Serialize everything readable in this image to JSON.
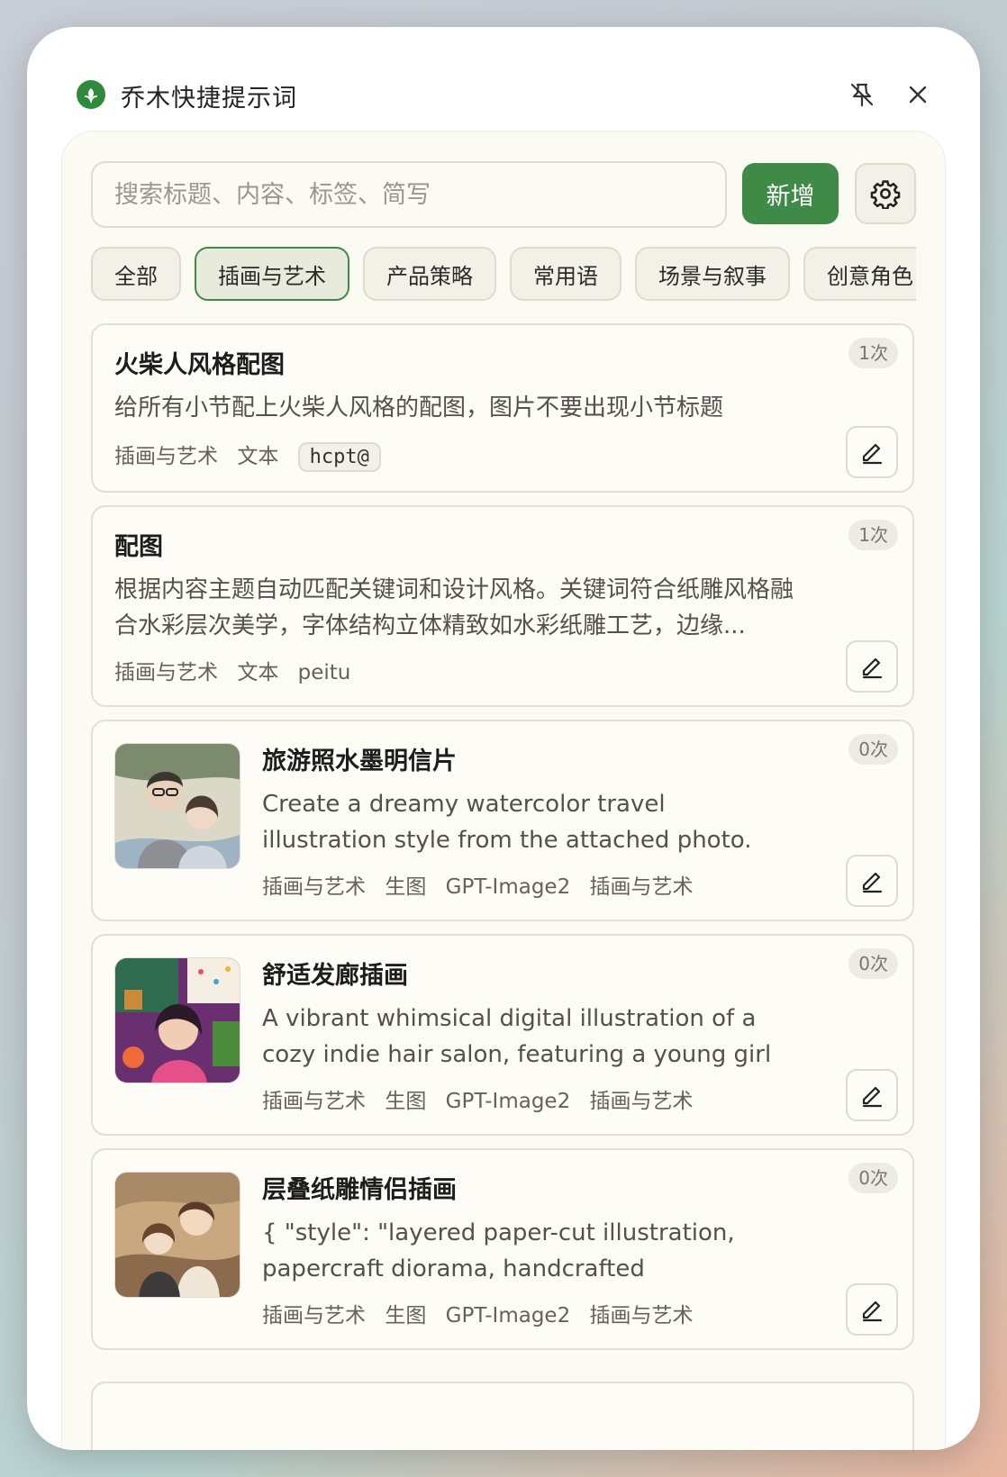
{
  "window": {
    "title": "乔木快捷提示词"
  },
  "toolbar": {
    "search_placeholder": "搜索标题、内容、标签、简写",
    "new_label": "新增"
  },
  "tabs": [
    {
      "label": "全部",
      "active": false
    },
    {
      "label": "插画与艺术",
      "active": true
    },
    {
      "label": "产品策略",
      "active": false
    },
    {
      "label": "常用语",
      "active": false
    },
    {
      "label": "场景与叙事",
      "active": false
    },
    {
      "label": "创意角色",
      "active": false
    }
  ],
  "cards": [
    {
      "title": "火柴人风格配图",
      "desc": "给所有小节配上火柴人风格的配图，图片不要出现小节标题",
      "tags": [
        "插画与艺术",
        "文本"
      ],
      "shortcut": "hcpt@",
      "count": "1次"
    },
    {
      "title": "配图",
      "desc": "根据内容主题自动匹配关键词和设计风格。关键词符合纸雕风格融合水彩层次美学，字体结构立体精致如水彩纸雕工艺，边缘...",
      "tags": [
        "插画与艺术",
        "文本",
        "peitu"
      ],
      "count": "1次"
    },
    {
      "title": "旅游照水墨明信片",
      "desc": "Create a dreamy watercolor travel illustration style from the attached photo. Use hand-...",
      "tags": [
        "插画与艺术",
        "生图",
        "GPT-Image2",
        "插画与艺术"
      ],
      "count": "0次"
    },
    {
      "title": "舒适发廊插画",
      "desc": "A vibrant whimsical digital illustration of a cozy indie hair salon, featuring a young girl with lon...",
      "tags": [
        "插画与艺术",
        "生图",
        "GPT-Image2",
        "插画与艺术"
      ],
      "count": "0次"
    },
    {
      "title": "层叠纸雕情侣插画",
      "desc": "{ \"style\": \"layered paper-cut illustration, papercraft diorama, handcrafted aesthetic\",...",
      "tags": [
        "插画与艺术",
        "生图",
        "GPT-Image2",
        "插画与艺术"
      ],
      "count": "0次"
    }
  ],
  "colors": {
    "accent": "#3f8a47",
    "panel_bg": "#fbfaf3",
    "border": "#dedbd0"
  },
  "icons": {
    "logo": "leaf-logo-icon",
    "pin": "unpin-icon",
    "close": "close-icon",
    "settings": "gear-icon",
    "edit": "pencil-icon"
  }
}
